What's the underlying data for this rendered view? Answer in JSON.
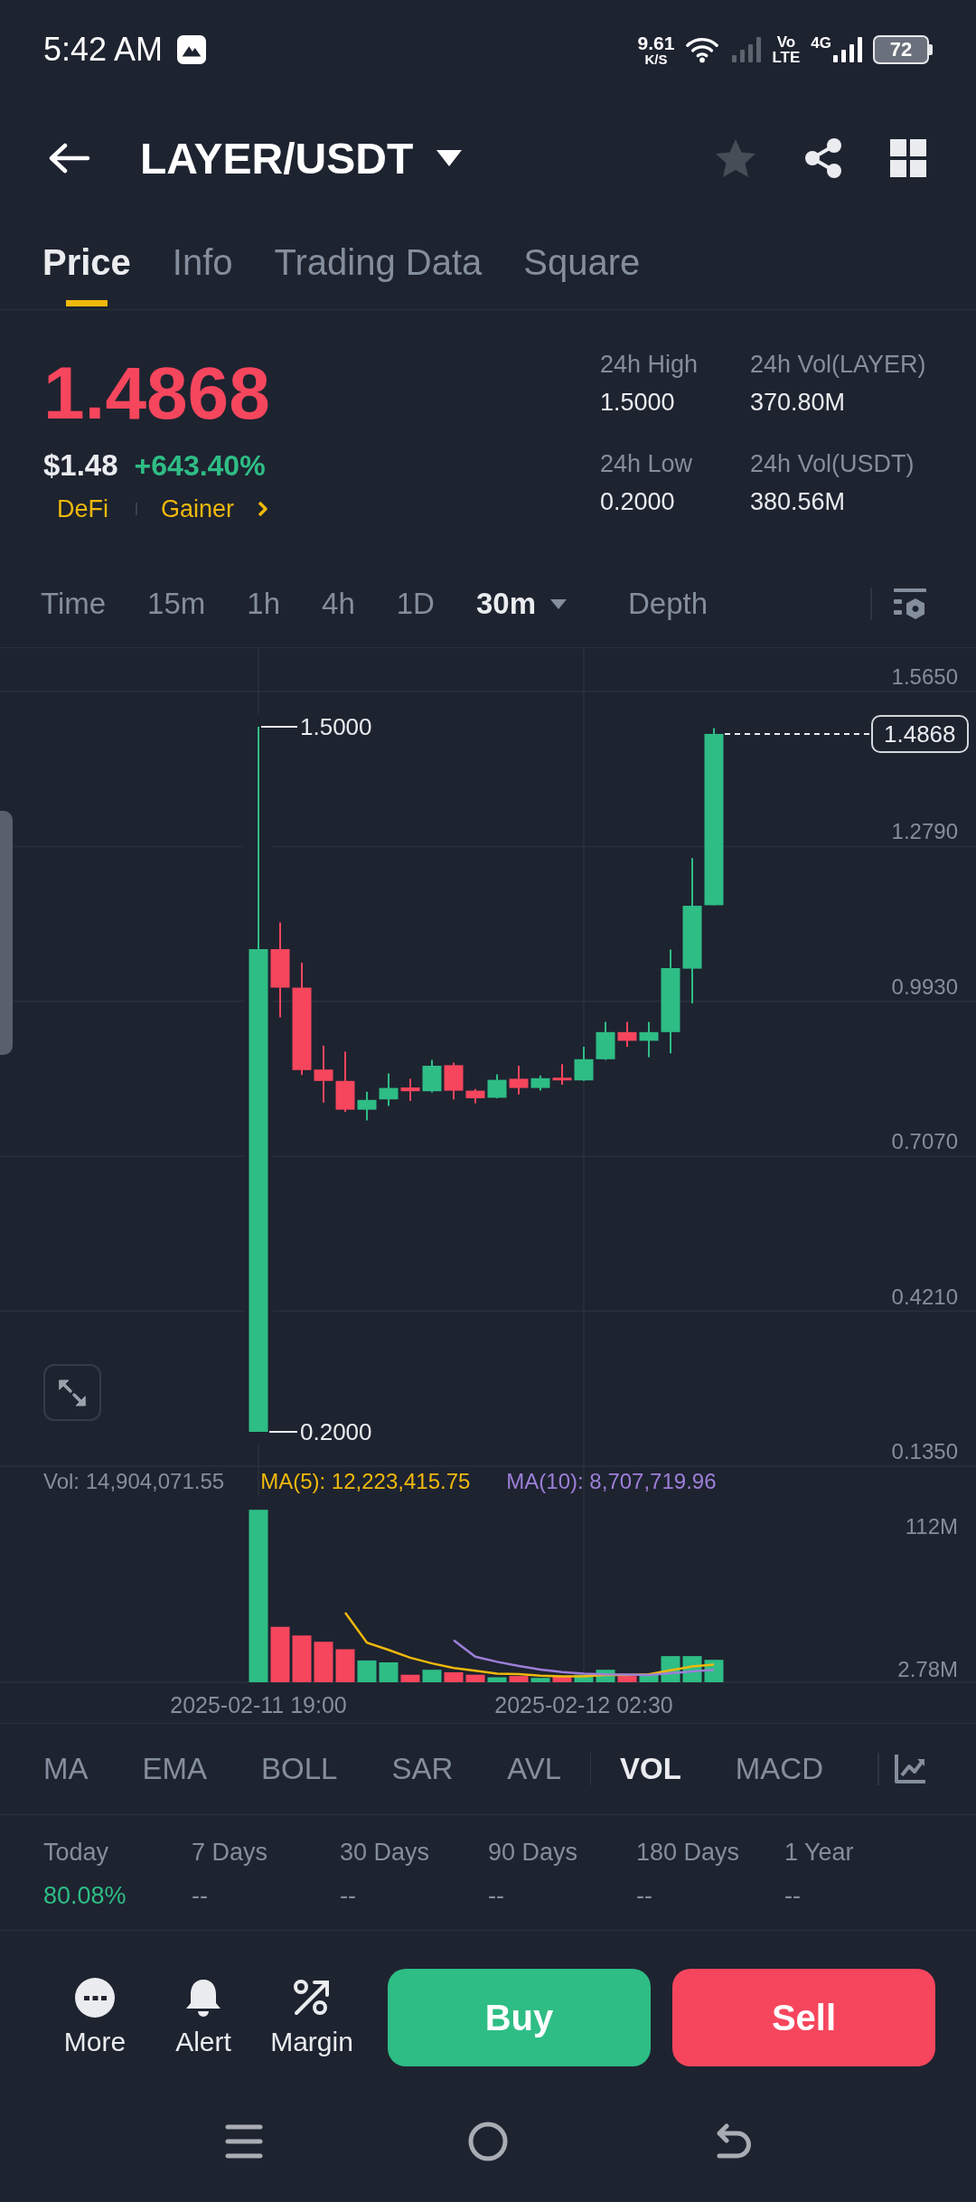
{
  "status_bar": {
    "time": "5:42 AM",
    "net_speed": "9.61",
    "net_speed_unit": "K/S",
    "volte_top": "Vo",
    "volte_bottom": "LTE",
    "network": "4G",
    "battery": "72"
  },
  "header": {
    "title": "LAYER/USDT",
    "favorite": false
  },
  "tabs": [
    {
      "label": "Price",
      "selected": true
    },
    {
      "label": "Info",
      "selected": false
    },
    {
      "label": "Trading Data",
      "selected": false
    },
    {
      "label": "Square",
      "selected": false
    }
  ],
  "ticker": {
    "price": "1.4868",
    "price_rising": false,
    "usd_price": "$1.48",
    "change": "+643.40%",
    "change_rising": true,
    "tags": [
      {
        "label": "DeFi"
      },
      {
        "label": "Gainer"
      }
    ],
    "stats": [
      {
        "label": "24h High",
        "value": "1.5000"
      },
      {
        "label": "24h Vol(LAYER)",
        "value": "370.80M"
      },
      {
        "label": "24h Low",
        "value": "0.2000"
      },
      {
        "label": "24h Vol(USDT)",
        "value": "380.56M"
      }
    ]
  },
  "intervals": [
    {
      "label": "Time",
      "kind": "option",
      "selected": false
    },
    {
      "label": "15m",
      "kind": "option",
      "selected": false
    },
    {
      "label": "1h",
      "kind": "option",
      "selected": false
    },
    {
      "label": "4h",
      "kind": "option",
      "selected": false
    },
    {
      "label": "1D",
      "kind": "option",
      "selected": false
    },
    {
      "label": "30m",
      "kind": "dropdown",
      "selected": true
    },
    {
      "label": "Depth",
      "kind": "option",
      "selected": false
    }
  ],
  "chart": {
    "price_axis": [
      "1.5650",
      "1.2790",
      "0.9930",
      "0.7070",
      "0.4210",
      "0.1350"
    ],
    "high_label": "1.5000",
    "low_label": "0.2000",
    "last_price": "1.4868",
    "volume_legend": [
      {
        "label": "Vol: 14,904,071.55",
        "color": "#848e9c"
      },
      {
        "label": "MA(5): 12,223,415.75",
        "color": "#f0b90b"
      },
      {
        "label": "MA(10): 8,707,719.96",
        "color": "#9d7fd8"
      }
    ],
    "volume_axis": [
      "112M",
      "2.78M"
    ],
    "time_axis": [
      "2025-02-11 19:00",
      "2025-02-12 02:30"
    ]
  },
  "indicators": {
    "main": [
      {
        "label": "MA",
        "selected": false
      },
      {
        "label": "EMA",
        "selected": false
      },
      {
        "label": "BOLL",
        "selected": false
      },
      {
        "label": "SAR",
        "selected": false
      },
      {
        "label": "AVL",
        "selected": false
      }
    ],
    "sub": [
      {
        "label": "VOL",
        "selected": true
      },
      {
        "label": "MACD",
        "selected": false
      }
    ]
  },
  "performance": [
    {
      "label": "Today",
      "value": "80.08%",
      "rising": true
    },
    {
      "label": "7 Days",
      "value": "--",
      "rising": false
    },
    {
      "label": "30 Days",
      "value": "--",
      "rising": false
    },
    {
      "label": "90 Days",
      "value": "--",
      "rising": false
    },
    {
      "label": "180 Days",
      "value": "--",
      "rising": false
    },
    {
      "label": "1 Year",
      "value": "--",
      "rising": false
    }
  ],
  "actions": [
    {
      "label": "More",
      "kind": "more"
    },
    {
      "label": "Alert",
      "kind": "alert"
    },
    {
      "label": "Margin",
      "kind": "margin"
    }
  ],
  "trade_buttons": [
    {
      "label": "Buy",
      "kind": "buy"
    },
    {
      "label": "Sell",
      "kind": "sell"
    }
  ]
}
